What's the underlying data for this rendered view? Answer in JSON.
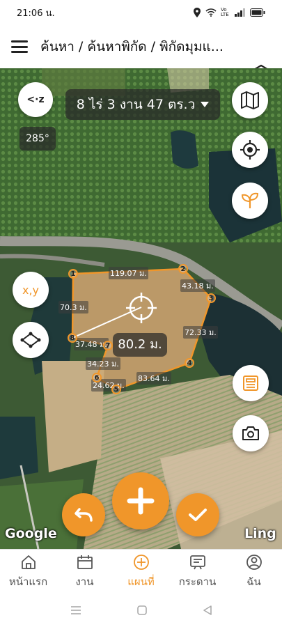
{
  "status_bar": {
    "time": "21:06 น.",
    "icons": [
      "location-icon",
      "wifi-icon",
      "signal-icon",
      "battery-icon"
    ],
    "network": "Vo LTE"
  },
  "header": {
    "breadcrumb": "ค้นหา / ค้นหาพิกัด / พิกัดมุมแ..."
  },
  "map": {
    "compass_label": "<·z",
    "area_text": "8 ไร่ 3 งาน 47 ตร.ว",
    "bearing": "285°",
    "xy_label": "x,y",
    "distance_label": "80.2 ม.",
    "google_label": "Google",
    "ling_label": "Ling",
    "polygon_color": "#f0962a",
    "vertices": [
      "1",
      "2",
      "3",
      "4",
      "5",
      "6",
      "7",
      "8"
    ],
    "segment_labels": [
      "119.07 ม.",
      "43.18 ม.",
      "72.33 ม.",
      "83.64 ม.",
      "24.62 ม.",
      "34.23 ม.",
      "37.48 ม.",
      "70.3 ม."
    ]
  },
  "bottom_nav": [
    {
      "label": "หน้าแรก",
      "icon": "home-icon"
    },
    {
      "label": "งาน",
      "icon": "calendar-icon"
    },
    {
      "label": "แผนที่",
      "icon": "add-circle-icon",
      "active": true
    },
    {
      "label": "กระดาน",
      "icon": "board-icon"
    },
    {
      "label": "ฉัน",
      "icon": "profile-icon"
    }
  ],
  "colors": {
    "accent": "#f0962a",
    "active_nav": "#f0962a"
  }
}
